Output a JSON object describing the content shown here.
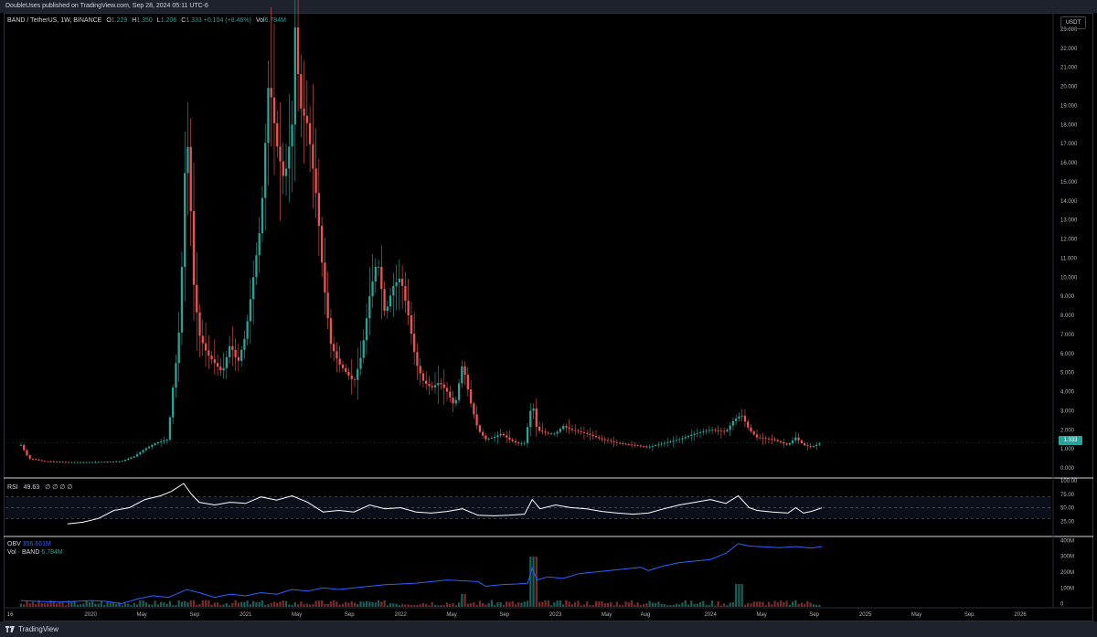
{
  "header": {
    "publisher": "DoubleUses published on TradingView.com, Sep 28, 2024 05:11 UTC-6"
  },
  "legend": {
    "symbol": "BAND / TetherUS, 1W, BINANCE",
    "o_label": "O",
    "o": "1.229",
    "h_label": "H",
    "h": "1.350",
    "l_label": "L",
    "l": "1.206",
    "c_label": "C",
    "c": "1.333",
    "change": "+0.104 (+8.46%)",
    "vol_label": "Vol",
    "vol": "6.784M"
  },
  "currency_button": "USDT",
  "last_price": "1.333",
  "rsi": {
    "label": "RSI",
    "value": "49.63",
    "extra": "∅ ∅ ∅ ∅"
  },
  "obv": {
    "label": "OBV",
    "value": "356.661M",
    "vol_label": "Vol · BAND",
    "vol_value": "6.784M"
  },
  "footer": {
    "brand": "TradingView"
  },
  "colors": {
    "up": "#26a69a",
    "down": "#ef5350",
    "obv": "#2962ff",
    "rsi": "#ffffff"
  },
  "chart_data": {
    "type": "candlestick",
    "price_axis_labels": [
      "23.000",
      "22.000",
      "21.000",
      "20.000",
      "19.000",
      "18.000",
      "17.000",
      "16.000",
      "15.000",
      "14.000",
      "13.000",
      "12.000",
      "11.000",
      "10.000",
      "9.000",
      "8.000",
      "7.000",
      "6.000",
      "5.000",
      "4.000",
      "3.000",
      "2.000",
      "1.000",
      "0.000"
    ],
    "rsi_axis_labels": [
      "100.00",
      "75.00",
      "50.00",
      "25.00"
    ],
    "obv_axis_labels": [
      "400M",
      "300M",
      "200M",
      "100M",
      "0"
    ],
    "time_axis_labels": [
      "16",
      "2020",
      "May",
      "Sep",
      "2021",
      "May",
      "Sep",
      "2022",
      "May",
      "Sep",
      "2023",
      "May",
      "Aug",
      "2024",
      "May",
      "Sep",
      "2025",
      "May",
      "Sep",
      "2026"
    ],
    "price_range": [
      0,
      23
    ],
    "rsi_range": [
      0,
      100
    ],
    "obv_range": [
      -20,
      420
    ],
    "price_path": [
      [
        2019.55,
        1.2
      ],
      [
        2019.6,
        0.5
      ],
      [
        2019.7,
        0.35
      ],
      [
        2019.85,
        0.3
      ],
      [
        2020.0,
        0.3
      ],
      [
        2020.1,
        0.32
      ],
      [
        2020.2,
        0.35
      ],
      [
        2020.28,
        0.6
      ],
      [
        2020.35,
        1.0
      ],
      [
        2020.42,
        1.3
      ],
      [
        2020.5,
        1.5
      ],
      [
        2020.52,
        3.5
      ],
      [
        2020.55,
        5.5
      ],
      [
        2020.58,
        8
      ],
      [
        2020.6,
        14
      ],
      [
        2020.62,
        17.8
      ],
      [
        2020.64,
        15
      ],
      [
        2020.66,
        10
      ],
      [
        2020.7,
        7
      ],
      [
        2020.75,
        6
      ],
      [
        2020.8,
        5.5
      ],
      [
        2020.85,
        5
      ],
      [
        2020.9,
        6.5
      ],
      [
        2020.95,
        5.5
      ],
      [
        2021.0,
        7
      ],
      [
        2021.05,
        10
      ],
      [
        2021.1,
        13
      ],
      [
        2021.15,
        20.5
      ],
      [
        2021.2,
        17
      ],
      [
        2021.25,
        15
      ],
      [
        2021.3,
        18
      ],
      [
        2021.32,
        23.3
      ],
      [
        2021.35,
        19
      ],
      [
        2021.4,
        18
      ],
      [
        2021.43,
        16
      ],
      [
        2021.46,
        14
      ],
      [
        2021.5,
        10
      ],
      [
        2021.55,
        6.5
      ],
      [
        2021.6,
        5.5
      ],
      [
        2021.65,
        5
      ],
      [
        2021.7,
        4.5
      ],
      [
        2021.75,
        6
      ],
      [
        2021.8,
        9
      ],
      [
        2021.85,
        11
      ],
      [
        2021.9,
        8
      ],
      [
        2021.95,
        9.5
      ],
      [
        2022.0,
        10
      ],
      [
        2022.05,
        8
      ],
      [
        2022.1,
        5.5
      ],
      [
        2022.15,
        4.5
      ],
      [
        2022.2,
        4.2
      ],
      [
        2022.25,
        4.5
      ],
      [
        2022.3,
        4
      ],
      [
        2022.35,
        3.2
      ],
      [
        2022.4,
        5.5
      ],
      [
        2022.45,
        3.5
      ],
      [
        2022.5,
        2
      ],
      [
        2022.55,
        1.5
      ],
      [
        2022.6,
        1.6
      ],
      [
        2022.65,
        1.8
      ],
      [
        2022.7,
        1.5
      ],
      [
        2022.75,
        1.3
      ],
      [
        2022.8,
        1.3
      ],
      [
        2022.85,
        3.5
      ],
      [
        2022.88,
        2
      ],
      [
        2022.95,
        1.8
      ],
      [
        2023.0,
        1.8
      ],
      [
        2023.05,
        2.2
      ],
      [
        2023.1,
        2
      ],
      [
        2023.2,
        1.8
      ],
      [
        2023.3,
        1.5
      ],
      [
        2023.4,
        1.3
      ],
      [
        2023.5,
        1.2
      ],
      [
        2023.6,
        1.1
      ],
      [
        2023.7,
        1.3
      ],
      [
        2023.8,
        1.5
      ],
      [
        2023.9,
        1.8
      ],
      [
        2024.0,
        2.0
      ],
      [
        2024.1,
        1.9
      ],
      [
        2024.15,
        2.5
      ],
      [
        2024.2,
        2.8
      ],
      [
        2024.25,
        2
      ],
      [
        2024.3,
        1.6
      ],
      [
        2024.4,
        1.5
      ],
      [
        2024.5,
        1.2
      ],
      [
        2024.55,
        1.6
      ],
      [
        2024.6,
        1.2
      ],
      [
        2024.65,
        1.1
      ],
      [
        2024.72,
        1.333
      ]
    ],
    "rsi_path": [
      [
        2019.85,
        20
      ],
      [
        2019.95,
        23
      ],
      [
        2020.05,
        30
      ],
      [
        2020.15,
        45
      ],
      [
        2020.25,
        50
      ],
      [
        2020.35,
        65
      ],
      [
        2020.45,
        72
      ],
      [
        2020.52,
        80
      ],
      [
        2020.6,
        95
      ],
      [
        2020.65,
        75
      ],
      [
        2020.7,
        60
      ],
      [
        2020.8,
        55
      ],
      [
        2020.9,
        60
      ],
      [
        2021.0,
        58
      ],
      [
        2021.1,
        70
      ],
      [
        2021.2,
        64
      ],
      [
        2021.3,
        72
      ],
      [
        2021.4,
        60
      ],
      [
        2021.5,
        42
      ],
      [
        2021.6,
        45
      ],
      [
        2021.7,
        42
      ],
      [
        2021.8,
        55
      ],
      [
        2021.9,
        48
      ],
      [
        2022.0,
        50
      ],
      [
        2022.1,
        42
      ],
      [
        2022.2,
        40
      ],
      [
        2022.3,
        43
      ],
      [
        2022.4,
        48
      ],
      [
        2022.5,
        36
      ],
      [
        2022.6,
        35
      ],
      [
        2022.7,
        36
      ],
      [
        2022.8,
        38
      ],
      [
        2022.85,
        65
      ],
      [
        2022.9,
        48
      ],
      [
        2023.0,
        55
      ],
      [
        2023.1,
        50
      ],
      [
        2023.2,
        48
      ],
      [
        2023.3,
        43
      ],
      [
        2023.4,
        40
      ],
      [
        2023.5,
        38
      ],
      [
        2023.6,
        40
      ],
      [
        2023.7,
        48
      ],
      [
        2023.8,
        55
      ],
      [
        2023.9,
        60
      ],
      [
        2024.0,
        65
      ],
      [
        2024.1,
        58
      ],
      [
        2024.18,
        72
      ],
      [
        2024.25,
        50
      ],
      [
        2024.3,
        45
      ],
      [
        2024.4,
        42
      ],
      [
        2024.5,
        40
      ],
      [
        2024.55,
        50
      ],
      [
        2024.6,
        40
      ],
      [
        2024.65,
        43
      ],
      [
        2024.72,
        49.63
      ]
    ],
    "obv_path": [
      [
        2019.55,
        20
      ],
      [
        2019.65,
        15
      ],
      [
        2019.8,
        10
      ],
      [
        2019.9,
        15
      ],
      [
        2020.0,
        20
      ],
      [
        2020.1,
        15
      ],
      [
        2020.2,
        0
      ],
      [
        2020.3,
        30
      ],
      [
        2020.4,
        50
      ],
      [
        2020.5,
        40
      ],
      [
        2020.55,
        60
      ],
      [
        2020.62,
        90
      ],
      [
        2020.7,
        70
      ],
      [
        2020.8,
        40
      ],
      [
        2020.9,
        60
      ],
      [
        2021.0,
        50
      ],
      [
        2021.1,
        70
      ],
      [
        2021.2,
        60
      ],
      [
        2021.3,
        90
      ],
      [
        2021.4,
        80
      ],
      [
        2021.5,
        100
      ],
      [
        2021.6,
        90
      ],
      [
        2021.7,
        100
      ],
      [
        2021.8,
        110
      ],
      [
        2021.9,
        120
      ],
      [
        2022.0,
        125
      ],
      [
        2022.1,
        130
      ],
      [
        2022.2,
        140
      ],
      [
        2022.3,
        150
      ],
      [
        2022.4,
        145
      ],
      [
        2022.5,
        140
      ],
      [
        2022.55,
        110
      ],
      [
        2022.65,
        120
      ],
      [
        2022.75,
        125
      ],
      [
        2022.82,
        130
      ],
      [
        2022.85,
        225
      ],
      [
        2022.88,
        150
      ],
      [
        2022.95,
        170
      ],
      [
        2023.05,
        160
      ],
      [
        2023.15,
        190
      ],
      [
        2023.25,
        200
      ],
      [
        2023.35,
        210
      ],
      [
        2023.45,
        220
      ],
      [
        2023.55,
        230
      ],
      [
        2023.6,
        210
      ],
      [
        2023.7,
        240
      ],
      [
        2023.8,
        260
      ],
      [
        2023.9,
        270
      ],
      [
        2024.0,
        280
      ],
      [
        2024.1,
        320
      ],
      [
        2024.18,
        380
      ],
      [
        2024.25,
        365
      ],
      [
        2024.35,
        360
      ],
      [
        2024.45,
        355
      ],
      [
        2024.55,
        362
      ],
      [
        2024.65,
        352
      ],
      [
        2024.72,
        362
      ]
    ]
  }
}
